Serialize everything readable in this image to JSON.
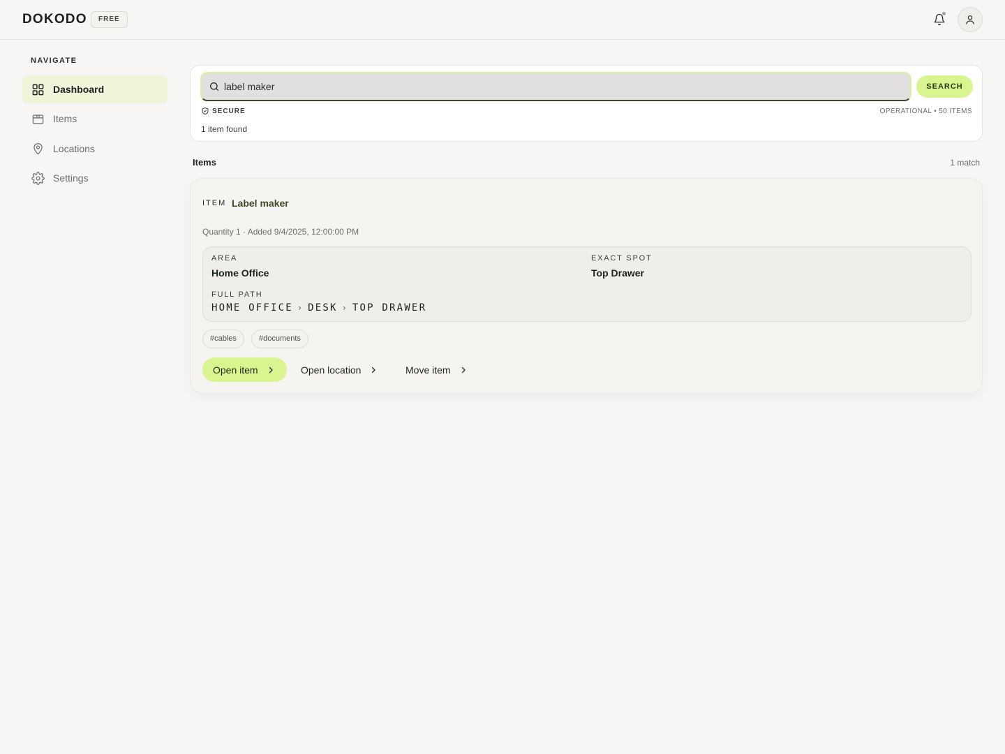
{
  "header": {
    "logo": "DOKODO",
    "plan": "FREE",
    "notification_icon": "bell-icon",
    "profile_icon": "user-icon"
  },
  "sidebar": {
    "heading": "NAVIGATE",
    "items": [
      {
        "label": "Dashboard",
        "icon": "grid-icon",
        "active": true
      },
      {
        "label": "Items",
        "icon": "box-icon",
        "active": false
      },
      {
        "label": "Locations",
        "icon": "map-pin-icon",
        "active": false
      },
      {
        "label": "Settings",
        "icon": "gear-icon",
        "active": false
      }
    ]
  },
  "search": {
    "value": "label maker",
    "button_label": "SEARCH",
    "secure_label": "SECURE",
    "status": "OPERATIONAL • 50 ITEMS",
    "result_count": "1 item found"
  },
  "results": {
    "section_title": "Items",
    "match_count": "1 match",
    "item": {
      "kicker": "ITEM",
      "name": "Label maker",
      "meta": "Quantity 1 · Added 9/4/2025, 12:00:00 PM",
      "area_label": "AREA",
      "area_value": "Home Office",
      "spot_label": "EXACT SPOT",
      "spot_value": "Top Drawer",
      "path_label": "FULL PATH",
      "path": [
        "HOME OFFICE",
        "DESK",
        "TOP DRAWER"
      ],
      "tags": [
        "#cables",
        "#documents"
      ],
      "actions": {
        "open_item": "Open item",
        "open_location": "Open location",
        "move_item": "Move item"
      }
    }
  },
  "colors": {
    "accent": "#d8f590",
    "active_nav_bg": "#eef5d9",
    "background": "#f7f6f4"
  }
}
